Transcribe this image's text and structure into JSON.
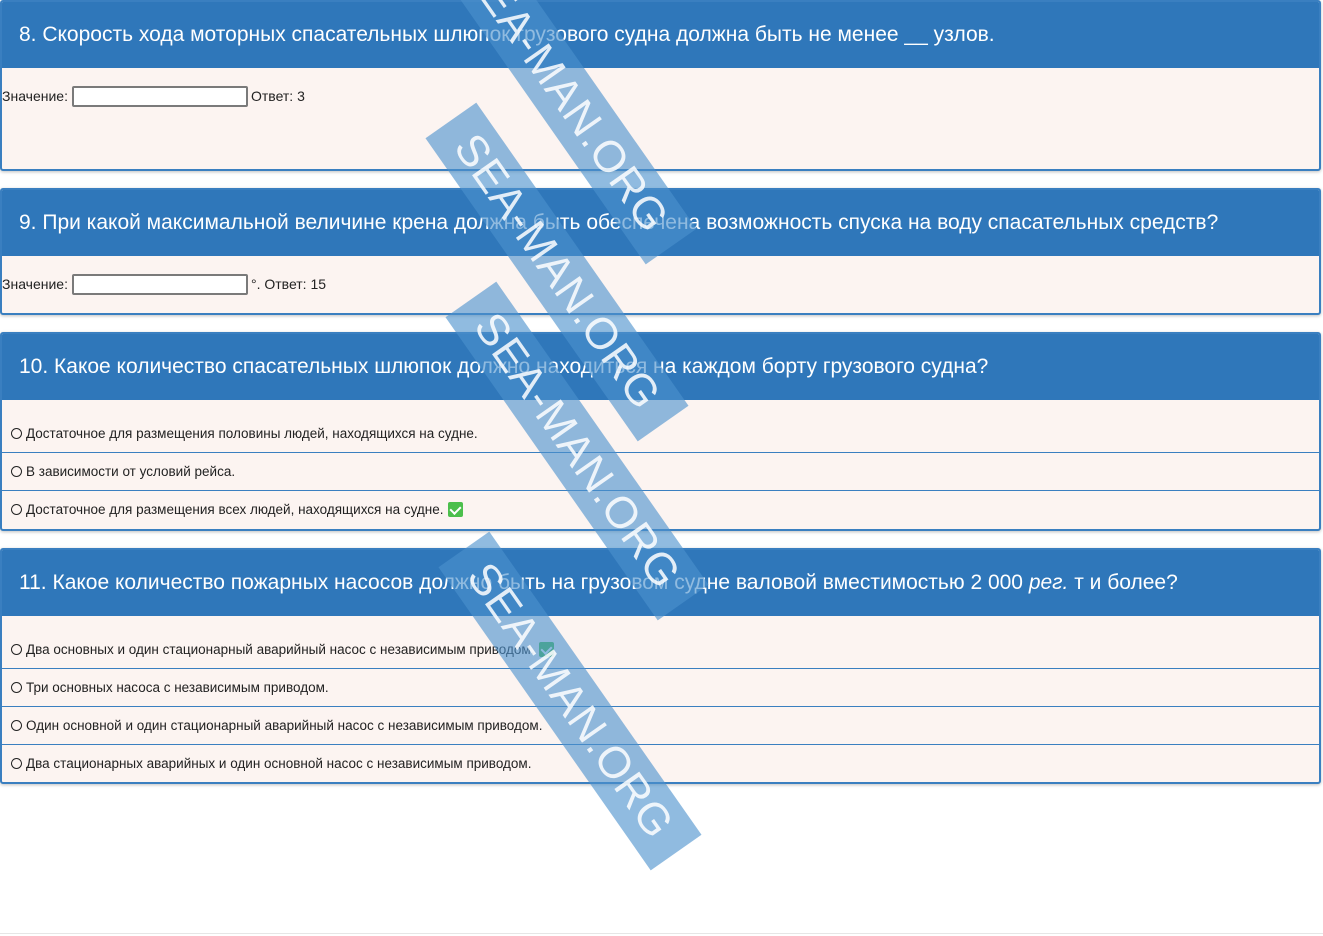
{
  "questions": [
    {
      "header": "8. Скорость хода моторных спасательных шлюпок грузового судна должна быть не менее __ узлов.",
      "value_label": "Значение:",
      "answer_text": "Ответ: 3"
    },
    {
      "header": "9. При какой максимальной величине крена должна быть обеспечена возможность спуска на воду спасательных средств?",
      "value_label": "Значение:",
      "answer_text": "°. Ответ: 15"
    },
    {
      "header": "10. Какое количество спасательных шлюпок должно находиться на каждом борту грузового судна?",
      "options": [
        {
          "text": "Достаточное для размещения половины людей, находящихся на судне.",
          "correct": false
        },
        {
          "text": "В зависимости от условий рейса.",
          "correct": false
        },
        {
          "text": "Достаточное для размещения всех людей, находящихся на судне.",
          "correct": true
        }
      ]
    },
    {
      "header_prefix": "11. Какое количество пожарных насосов должно быть на грузовом судне валовой вместимостью 2 000 ",
      "header_italic": "рег.",
      "header_suffix": " т и более?",
      "options": [
        {
          "text": "Два основных и один стационарный аварийный насос с независимым приводом.",
          "correct": true
        },
        {
          "text": "Три основных насоса с независимым приводом.",
          "correct": false
        },
        {
          "text": "Один основной и один стационарный аварийный насос с независимым приводом.",
          "correct": false
        },
        {
          "text": "Два стационарных аварийных и один основной насос с независимым приводом.",
          "correct": false
        }
      ]
    }
  ],
  "watermark_text": "SEA-MAN.ORG",
  "colors": {
    "header_bg": "#2f77ba",
    "body_bg": "#fcf4f1",
    "correct_badge": "#4cbf4c",
    "watermark": "#4c92cd"
  }
}
